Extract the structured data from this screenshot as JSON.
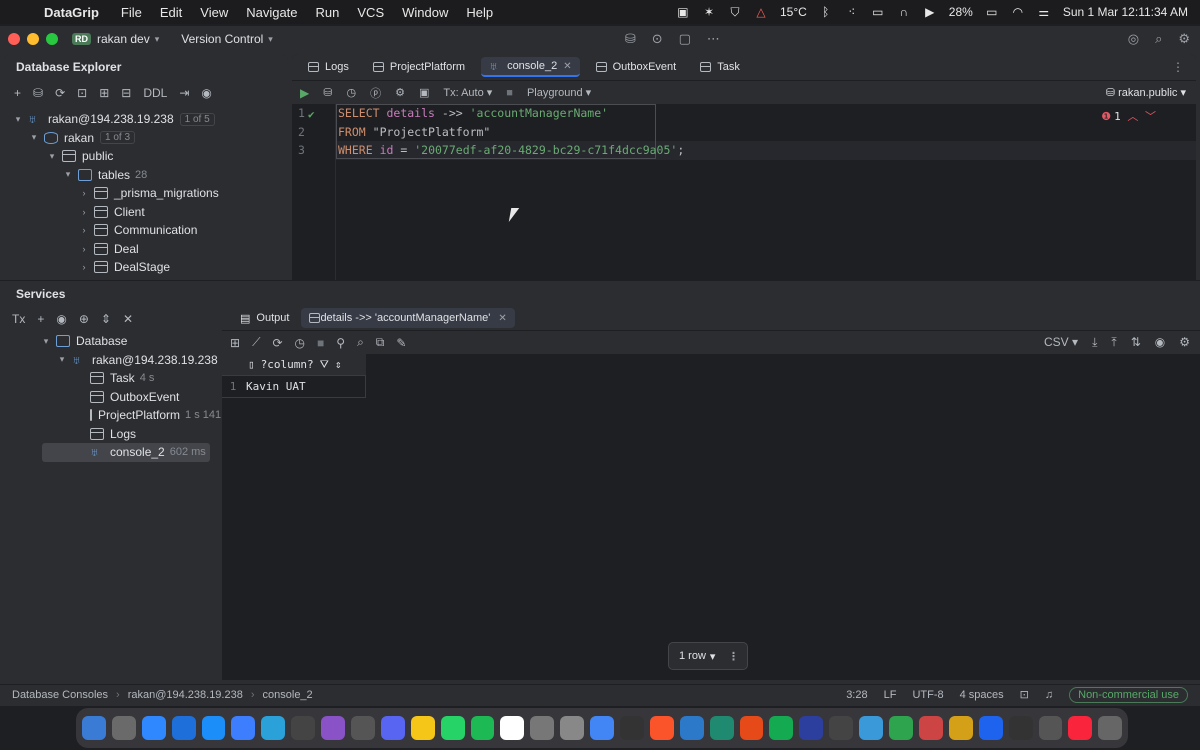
{
  "menubar": {
    "app_name": "DataGrip",
    "items": [
      "File",
      "Edit",
      "View",
      "Navigate",
      "Run",
      "VCS",
      "Window",
      "Help"
    ],
    "weather": "15°C",
    "battery": "28%",
    "datetime": "Sun 1 Mar  12:11:34 AM"
  },
  "titlebar": {
    "project_badge": "RD",
    "project": "rakan dev",
    "vcs": "Version Control"
  },
  "db_explorer": {
    "title": "Database Explorer",
    "ddl": "DDL",
    "tree": {
      "connection": "rakan@194.238.19.238",
      "connection_count": "1 of 5",
      "database": "rakan",
      "database_count": "1 of 3",
      "schema": "public",
      "tables_label": "tables",
      "tables_count": "28",
      "tables": [
        "_prisma_migrations",
        "Client",
        "Communication",
        "Deal",
        "DealStage"
      ]
    }
  },
  "editor": {
    "tabs": [
      "Logs",
      "ProjectPlatform",
      "console_2",
      "OutboxEvent",
      "Task"
    ],
    "active_tab": "console_2",
    "tx_mode": "Tx: Auto",
    "playground": "Playground",
    "schema": "rakan.public",
    "error_count": "1",
    "line_numbers": [
      "1",
      "2",
      "3"
    ],
    "code": {
      "l1_kw": "SELECT",
      "l1_rest": "details",
      "l1_op": "->>",
      "l1_str": "'accountManagerName'",
      "l2_kw": "FROM",
      "l2_ident": "\"ProjectPlatform\"",
      "l3_kw": "WHERE",
      "l3_ident": "id",
      "l3_op": "=",
      "l3_str": "'20077edf-af20-4829-bc29-c71f4dcc9a05'",
      "l3_end": ";"
    }
  },
  "services": {
    "title": "Services",
    "tx_label": "Tx",
    "tree": {
      "root": "Database",
      "connection": "rakan@194.238.19.238",
      "items": [
        {
          "name": "Task",
          "time": "4 s"
        },
        {
          "name": "OutboxEvent",
          "time": ""
        },
        {
          "name": "ProjectPlatform",
          "time": "1 s 141 r"
        },
        {
          "name": "Logs",
          "time": ""
        },
        {
          "name": "console_2",
          "time": "602 ms"
        }
      ]
    },
    "output_tabs": [
      "Output",
      "details ->> 'accountManagerName'"
    ],
    "csv": "CSV",
    "grid": {
      "column": "?column?",
      "rows": [
        {
          "num": "1",
          "value": "Kavin UAT"
        }
      ]
    },
    "row_count": "1 row"
  },
  "statusbar": {
    "crumbs": [
      "Database Consoles",
      "rakan@194.238.19.238",
      "console_2"
    ],
    "position": "3:28",
    "line_sep": "LF",
    "encoding": "UTF-8",
    "indent": "4 spaces",
    "license": "Non-commercial use"
  },
  "dock": {
    "colors": [
      "#3a7bd5",
      "#6a6a6a",
      "#2f88ff",
      "#1e6fd9",
      "#1c8ef9",
      "#3d7eff",
      "#2aa1d9",
      "#444",
      "#8a52c7",
      "#555",
      "#5865f2",
      "#f5c518",
      "#25d366",
      "#1db954",
      "#fff",
      "#777",
      "#888",
      "#4285f4",
      "#333",
      "#fb542b",
      "#2b79c8",
      "#1f8a70",
      "#e64a19",
      "#13aa52",
      "#2c3e9e",
      "#444",
      "#3a9ad9",
      "#2ea44f",
      "#c44",
      "#d4a017",
      "#1d63ed",
      "#333",
      "#555",
      "#fa243c",
      "#666"
    ]
  }
}
